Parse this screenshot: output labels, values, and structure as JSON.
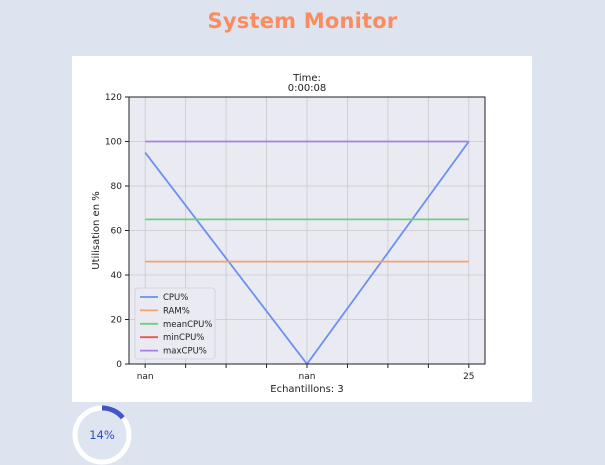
{
  "app": {
    "title": "System Monitor"
  },
  "colors": {
    "title": "#fb8c5f",
    "plot_bg": "#eaeaf2",
    "grid": "#c9c9cf",
    "gauge_track": "#ffffff",
    "gauge_fill": "#3f55c8",
    "gauge_inner": "#dfe4f1"
  },
  "chart_data": {
    "type": "line",
    "title_line1": "Time:",
    "title_line2": "0:00:08",
    "xlabel": "Echantillons: 3",
    "ylabel": "Utilisation en %",
    "ylim": [
      0,
      120
    ],
    "xlim": [
      -0.1,
      2.1
    ],
    "yticks": [
      0,
      20,
      40,
      60,
      80,
      100,
      120
    ],
    "xtick_labels": [
      {
        "x": 0,
        "label": "nan"
      },
      {
        "x": 1,
        "label": "nan"
      },
      {
        "x": 2,
        "label": "25"
      }
    ],
    "grid": true,
    "legend_position": "lower-left",
    "series": [
      {
        "name": "CPU%",
        "color": "#6c8ff2",
        "x": [
          0,
          1,
          2
        ],
        "y": [
          95,
          0,
          100
        ]
      },
      {
        "name": "RAM%",
        "color": "#f6a36a",
        "x": [
          0,
          2
        ],
        "y": [
          46,
          46
        ]
      },
      {
        "name": "meanCPU%",
        "color": "#6fcf7d",
        "x": [
          0,
          2
        ],
        "y": [
          65,
          65
        ]
      },
      {
        "name": "minCPU%",
        "color": "#e8555a",
        "x": [],
        "y": []
      },
      {
        "name": "maxCPU%",
        "color": "#a77ee8",
        "x": [
          0,
          2
        ],
        "y": [
          100,
          100
        ]
      }
    ]
  },
  "gauge": {
    "percent": 14,
    "label": "14%"
  }
}
